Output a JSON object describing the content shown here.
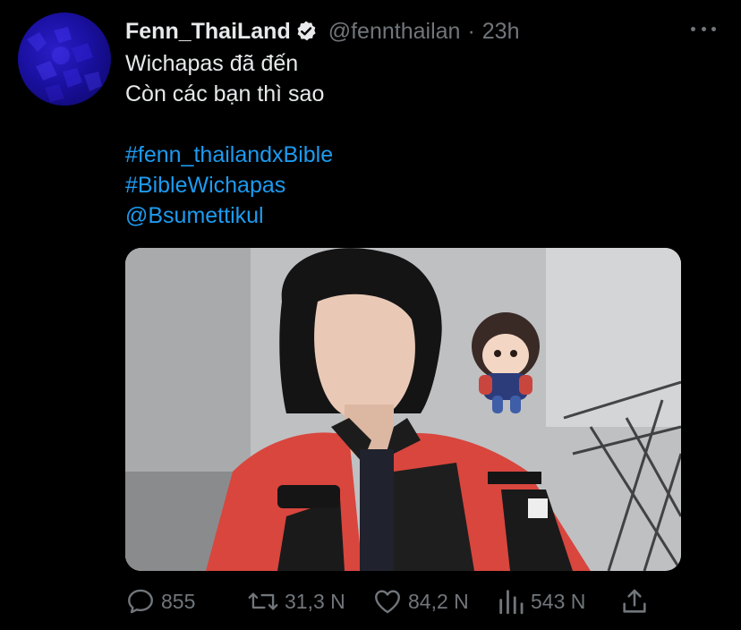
{
  "tweet": {
    "display_name": "Fenn_ThaiLand",
    "handle": "@fennthailan",
    "separator": "·",
    "time": "23h",
    "text_lines": [
      "Wichapas đã đến",
      "Còn các bạn thì sao"
    ],
    "hashtags": [
      "#fenn_thailandxBible",
      "#BibleWichapas"
    ],
    "mention": "@Bsumettikul"
  },
  "actions": {
    "replies": "855",
    "retweets": "31,3 N",
    "likes": "84,2 N",
    "views": "543 N"
  },
  "colors": {
    "background": "#000000",
    "text": "#e7e9ea",
    "secondary": "#71767b",
    "link": "#1d9bf0"
  },
  "icons": {
    "verified": "verified-badge-icon",
    "more": "more-dots-icon",
    "reply": "reply-bubble-icon",
    "retweet": "retweet-icon",
    "like": "heart-icon",
    "views": "views-bars-icon",
    "share": "share-upload-icon"
  }
}
